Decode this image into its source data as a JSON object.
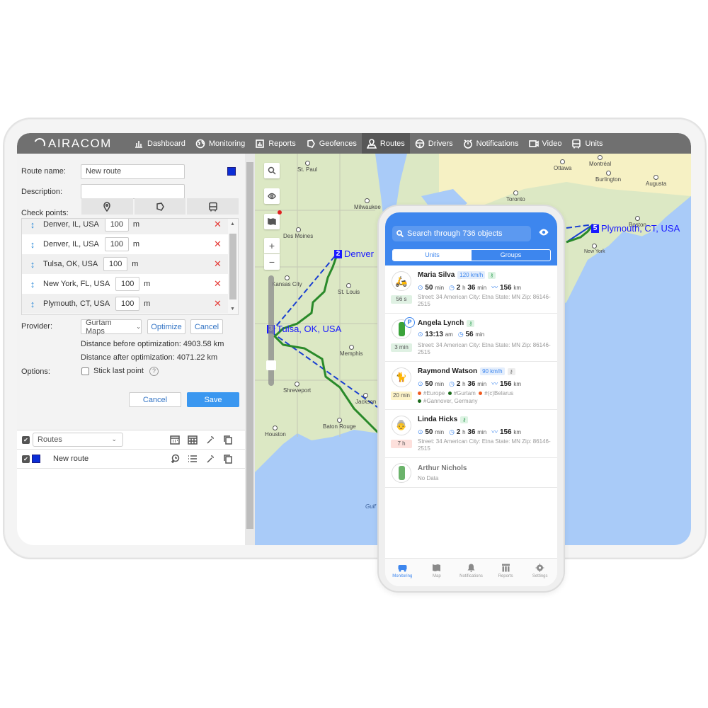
{
  "app": {
    "brand": "AIRACOM",
    "nav": [
      {
        "label": "Dashboard",
        "icon": "bar-chart-icon"
      },
      {
        "label": "Monitoring",
        "icon": "globe-icon"
      },
      {
        "label": "Reports",
        "icon": "report-icon"
      },
      {
        "label": "Geofences",
        "icon": "geofence-icon"
      },
      {
        "label": "Routes",
        "icon": "route-icon",
        "active": true
      },
      {
        "label": "Drivers",
        "icon": "steering-wheel-icon"
      },
      {
        "label": "Notifications",
        "icon": "alarm-clock-icon"
      },
      {
        "label": "Video",
        "icon": "video-icon"
      },
      {
        "label": "Units",
        "icon": "bus-icon"
      }
    ]
  },
  "route_form": {
    "route_name_label": "Route name:",
    "route_name_value": "New route",
    "route_color": "#0b2dd6",
    "description_label": "Description:",
    "description_value": "",
    "check_points_label": "Check points:",
    "check_point_tools": [
      "pin-icon",
      "geofence-icon",
      "bus-icon"
    ],
    "check_points": [
      {
        "name": "Denver, IL, USA",
        "radius": "100",
        "unit": "m"
      },
      {
        "name": "Denver, IL, USA",
        "radius": "100",
        "unit": "m"
      },
      {
        "name": "Tulsa, OK, USA",
        "radius": "100",
        "unit": "m"
      },
      {
        "name": "New York, FL, USA",
        "radius": "100",
        "unit": "m"
      },
      {
        "name": "Plymouth, CT, USA",
        "radius": "100",
        "unit": "m"
      }
    ],
    "provider_label": "Provider:",
    "provider_value": "Gurtam Maps",
    "optimize_label": "Optimize",
    "cancel_inline_label": "Cancel",
    "distance_before": "Distance before optimization: 4903.58 km",
    "distance_after": "Distance after optimization: 4071.22 km",
    "options_label": "Options:",
    "stick_last_point_label": "Stick last point",
    "stick_last_point_checked": false,
    "help_glyph": "?",
    "cancel_label": "Cancel",
    "save_label": "Save"
  },
  "route_list": {
    "filter_value": "Routes",
    "filter_checked": true,
    "items": [
      {
        "name": "New route",
        "checked": true,
        "color": "#0b2dd6"
      }
    ]
  },
  "map": {
    "cities": [
      "St. Paul",
      "Des Moines",
      "Kansas City",
      "St. Louis",
      "Memphis",
      "Shreveport",
      "Jackson",
      "Baton Rouge",
      "Houston",
      "Tulsa",
      "Ottawa",
      "Montréal",
      "Burlington",
      "Augusta",
      "Toronto",
      "Boston",
      "New York",
      "Milwaukee"
    ],
    "water_label": "Gulf of Me",
    "markers": [
      {
        "num": "2",
        "label": "Denver"
      },
      {
        "num": "3",
        "label": "Tulsa, OK, USA"
      },
      {
        "num": "5",
        "label": "Plymouth, CT, USA"
      }
    ]
  },
  "mobile": {
    "search_placeholder": "Search through 736 objects",
    "tabs": [
      {
        "label": "Units",
        "active": true
      },
      {
        "label": "Groups",
        "active": false
      }
    ],
    "units": [
      {
        "name": "Maria Silva",
        "speed": "120 km/h",
        "ago": "56 s",
        "ago_color": "#dff1e3",
        "s1": "50",
        "s1u": "min",
        "s2a": "2",
        "s2b": "h",
        "s2c": "36",
        "s2d": "min",
        "s3": "156",
        "s3u": "km",
        "address": "Street: 34 American City: Etna State: MN Zip: 86146-2515"
      },
      {
        "name": "Angela Lynch",
        "ago": "3 min",
        "ago_color": "#dff1e3",
        "s1": "13:13",
        "s1u": "am",
        "s2a": "56",
        "s2b": "min",
        "address": "Street: 34 American City: Etna State: MN Zip: 86146-2515"
      },
      {
        "name": "Raymond Watson",
        "speed": "90 km/h",
        "ago": "20 min",
        "ago_color": "#fdf3c8",
        "s1": "50",
        "s1u": "min",
        "s2a": "2",
        "s2b": "h",
        "s2c": "36",
        "s2d": "min",
        "s3": "156",
        "s3u": "km",
        "tags": [
          "#Europe",
          "#Gurtam",
          "#(c)Belarus",
          "#Gannover, Germany"
        ]
      },
      {
        "name": "Linda Hicks",
        "ago": "7 h",
        "ago_color": "#fde0dc",
        "s1": "50",
        "s1u": "min",
        "s2a": "2",
        "s2b": "h",
        "s2c": "36",
        "s2d": "min",
        "s3": "156",
        "s3u": "km",
        "address": "Street: 34 American City: Etna State: MN Zip: 86146-2515"
      },
      {
        "name": "Arthur Nichols",
        "status": "No Data"
      }
    ],
    "bottom_nav": [
      {
        "label": "Monitoring",
        "active": true
      },
      {
        "label": "Map"
      },
      {
        "label": "Notifications"
      },
      {
        "label": "Reports"
      },
      {
        "label": "Settings"
      }
    ]
  }
}
